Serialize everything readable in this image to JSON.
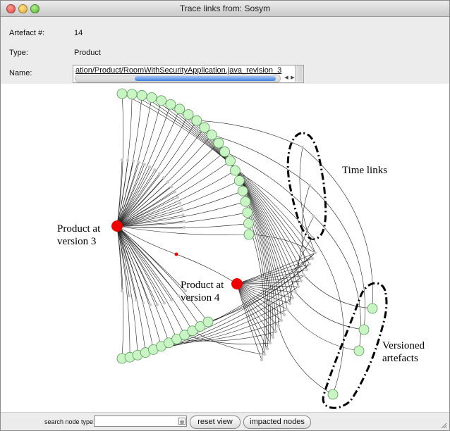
{
  "window": {
    "title": "Trace links from: Sosym"
  },
  "info": {
    "artefact_label": "Artefact #:",
    "artefact_value": "14",
    "type_label": "Type:",
    "type_value": "Product",
    "name_label": "Name:",
    "name_value": "ation/Product/RoomWithSecurityApplication.java_revision_3"
  },
  "graph": {
    "annotations": {
      "product_v3_line1": "Product at",
      "product_v3_line2": "version 3",
      "product_v4_line1": "Product at",
      "product_v4_line2": "version 4",
      "time_links": "Time links",
      "versioned_line1": "Versioned",
      "versioned_line2": "artefacts"
    },
    "colors": {
      "hub": "#ee0000",
      "leaf": "#c8f5c3",
      "leaf_stroke": "#5e9a5e",
      "intermediate": "#c8c8c8",
      "edge": "#222222"
    }
  },
  "toolbar": {
    "search_label": "search node type:",
    "search_value": "",
    "search_placeholder": "",
    "clear_icon": "⊗",
    "reset_label": "reset view",
    "impacted_label": "impacted nodes"
  }
}
